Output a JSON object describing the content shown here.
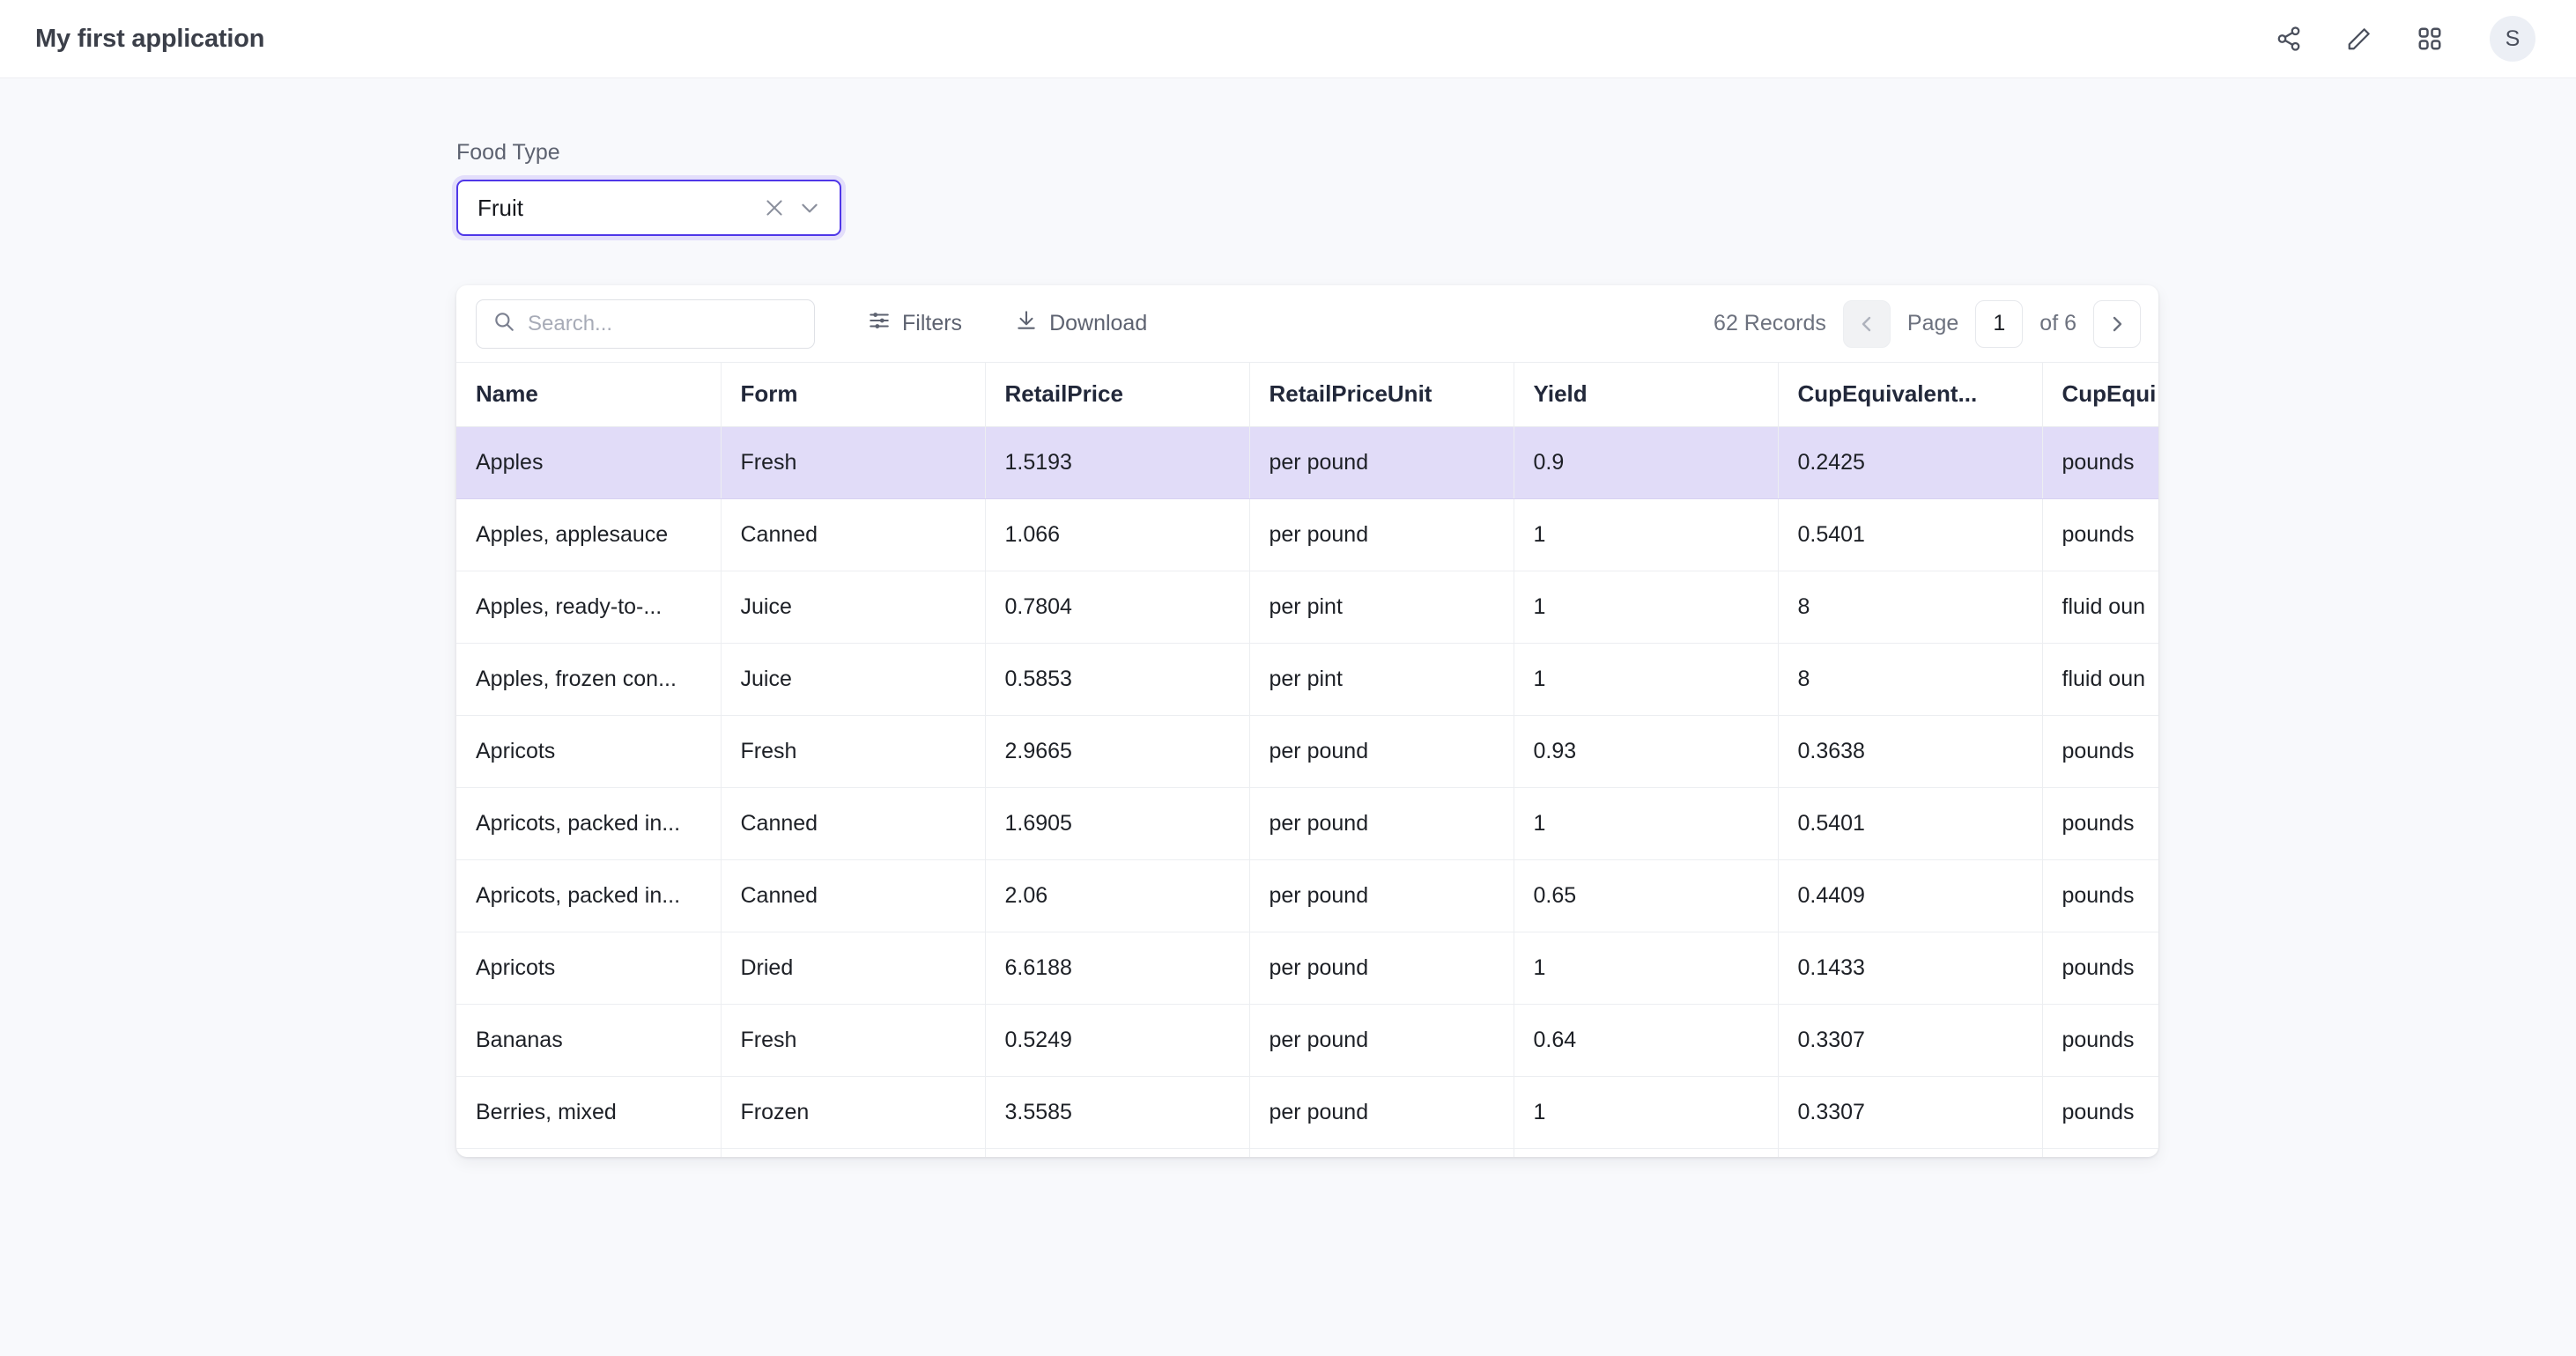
{
  "header": {
    "title": "My first application",
    "actions": [
      {
        "name": "share-icon",
        "label": "Share"
      },
      {
        "name": "edit-icon",
        "label": "Edit"
      },
      {
        "name": "apps-grid-icon",
        "label": "Apps"
      }
    ],
    "avatar_initial": "S"
  },
  "filter": {
    "label": "Food Type",
    "value": "Fruit",
    "clear_icon": "close-icon",
    "chevron_icon": "chevron-down-icon"
  },
  "toolbar": {
    "search_placeholder": "Search...",
    "search_value": "",
    "filters_label": "Filters",
    "download_label": "Download"
  },
  "pagination": {
    "records_label": "62 Records",
    "page_label": "Page",
    "page_value": "1",
    "of_label": "of 6",
    "prev_label": "Previous page",
    "next_label": "Next page"
  },
  "table": {
    "columns": [
      "Name",
      "Form",
      "RetailPrice",
      "RetailPriceUnit",
      "Yield",
      "CupEquivalent...",
      "CupEqui"
    ],
    "rows": [
      {
        "selected": true,
        "cells": [
          "Apples",
          "Fresh",
          "1.5193",
          "per pound",
          "0.9",
          "0.2425",
          "pounds"
        ]
      },
      {
        "selected": false,
        "cells": [
          "Apples, applesauce",
          "Canned",
          "1.066",
          "per pound",
          "1",
          "0.5401",
          "pounds"
        ]
      },
      {
        "selected": false,
        "cells": [
          "Apples, ready-to-...",
          "Juice",
          "0.7804",
          "per pint",
          "1",
          "8",
          "fluid oun"
        ]
      },
      {
        "selected": false,
        "cells": [
          "Apples, frozen con...",
          "Juice",
          "0.5853",
          "per pint",
          "1",
          "8",
          "fluid oun"
        ]
      },
      {
        "selected": false,
        "cells": [
          "Apricots",
          "Fresh",
          "2.9665",
          "per pound",
          "0.93",
          "0.3638",
          "pounds"
        ]
      },
      {
        "selected": false,
        "cells": [
          "Apricots, packed in...",
          "Canned",
          "1.6905",
          "per pound",
          "1",
          "0.5401",
          "pounds"
        ]
      },
      {
        "selected": false,
        "cells": [
          "Apricots, packed in...",
          "Canned",
          "2.06",
          "per pound",
          "0.65",
          "0.4409",
          "pounds"
        ]
      },
      {
        "selected": false,
        "cells": [
          "Apricots",
          "Dried",
          "6.6188",
          "per pound",
          "1",
          "0.1433",
          "pounds"
        ]
      },
      {
        "selected": false,
        "cells": [
          "Bananas",
          "Fresh",
          "0.5249",
          "per pound",
          "0.64",
          "0.3307",
          "pounds"
        ]
      },
      {
        "selected": false,
        "cells": [
          "Berries, mixed",
          "Frozen",
          "3.5585",
          "per pound",
          "1",
          "0.3307",
          "pounds"
        ]
      },
      {
        "selected": false,
        "cells": [
          "",
          "",
          "",
          "",
          "",
          "",
          ""
        ]
      }
    ]
  },
  "colors": {
    "accent": "#4f37e8",
    "selected_row": "#e1dcf8",
    "page_background": "#f8f9fc",
    "header_text": "#22283a"
  }
}
